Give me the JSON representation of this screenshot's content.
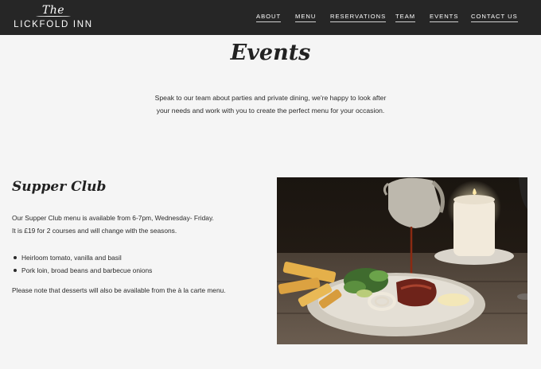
{
  "brand": {
    "logo_the": "The",
    "logo_name": "LICKFOLD INN"
  },
  "nav": {
    "about": "ABOUT",
    "menu": "MENU",
    "reservations": "RESERVATIONS",
    "team": "TEAM",
    "events": "EVENTS",
    "contact": "CONTACT US"
  },
  "page": {
    "title": "Events",
    "intro_line1": "Speak to our team about parties and private dining, we're happy to look after",
    "intro_line2": "your needs and work with you to create the perfect menu for your occasion."
  },
  "supper_club": {
    "title": "Supper Club",
    "line1": "Our Supper Club menu is available from 6-7pm, Wednesday- Friday.",
    "line2": "It is £19 for 2 courses and will change with the seasons.",
    "items": [
      "Heirloom tomato, vanilla and basil",
      "Pork loin, broad beans and barbecue onions"
    ],
    "note": "Please note that desserts will also be available from the à la carte menu."
  },
  "colors": {
    "topbar": "#262626",
    "background": "#f5f5f5",
    "text": "#222222"
  }
}
